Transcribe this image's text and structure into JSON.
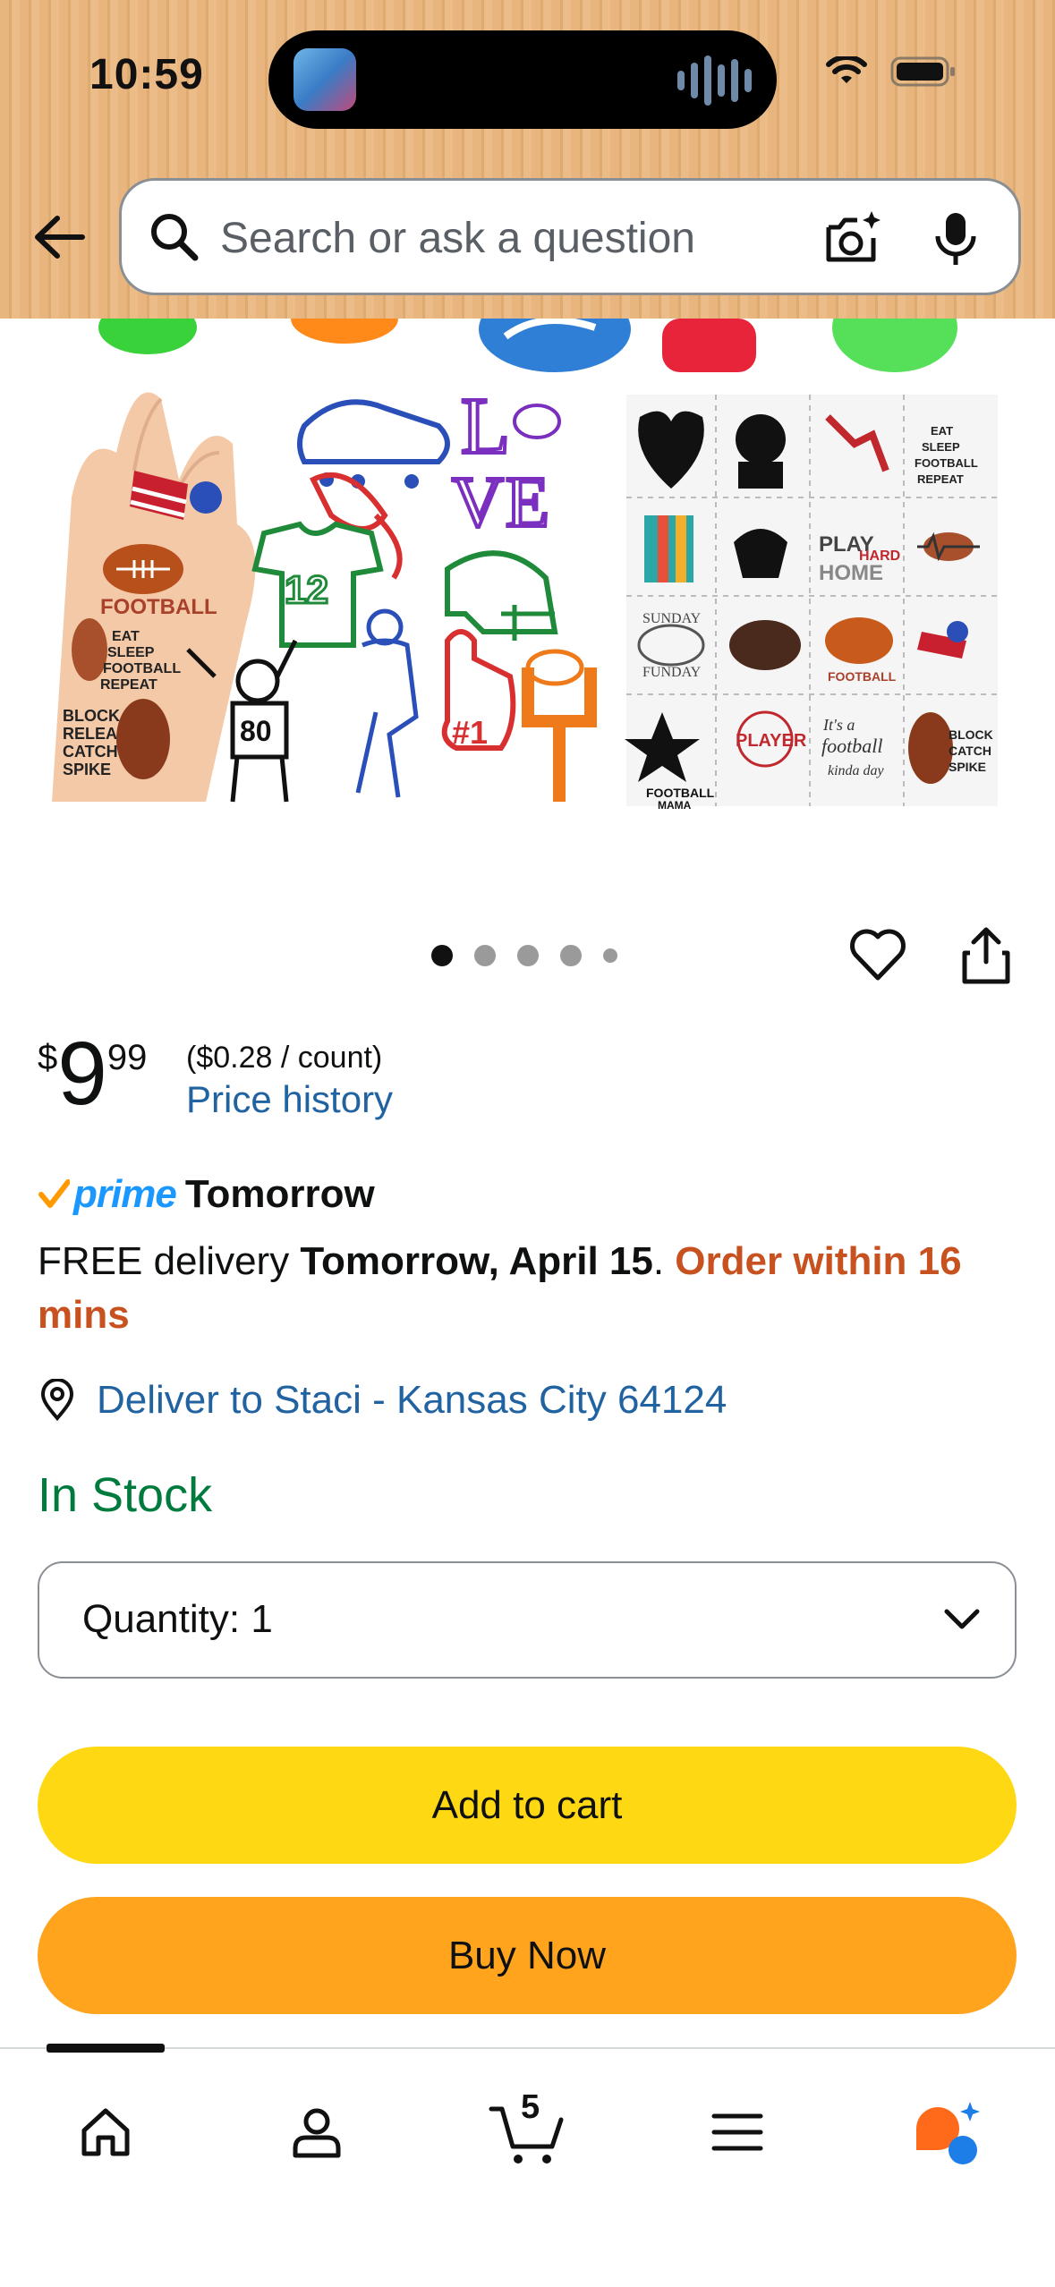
{
  "status_bar": {
    "time": "10:59"
  },
  "search": {
    "placeholder": "Search or ask a question"
  },
  "product": {
    "image_count": 5,
    "active_image": 1,
    "price_symbol": "$",
    "price_whole": "9",
    "price_fraction": "99",
    "unit_price": "($0.28 / count)",
    "price_history_label": "Price history",
    "prime_label": "prime",
    "prime_when": "Tomorrow",
    "delivery_prefix": "FREE delivery ",
    "delivery_date": "Tomorrow, April 15",
    "delivery_sep": ". ",
    "order_within": "Order within 16 mins",
    "deliver_to": "Deliver to Staci - Kansas City 64124",
    "stock_status": "In Stock",
    "quantity_label": "Quantity:",
    "quantity_value": "1",
    "add_to_cart": "Add to cart",
    "buy_now": "Buy Now",
    "sticker_texts": [
      "FOOTBALL",
      "EAT SLEEP FOOTBALL REPEAT",
      "BLOCK RELEASE CATCH SPIKE",
      "LOVE",
      "12",
      "80",
      "#1",
      "PLAY HARD",
      "SUNDAY FUNDAY",
      "FOOTBALL MAMA"
    ]
  },
  "nav": {
    "items": [
      "home-icon",
      "account-icon",
      "cart-icon",
      "menu-icon",
      "rufus-icon"
    ],
    "cart_count": "5"
  },
  "colors": {
    "link": "#2162a1",
    "in_stock": "#007a3d",
    "urgent": "#c7511f",
    "add_to_cart_bg": "#ffd814",
    "buy_now_bg": "#ffa41c",
    "prime_blue": "#1a98ff"
  }
}
